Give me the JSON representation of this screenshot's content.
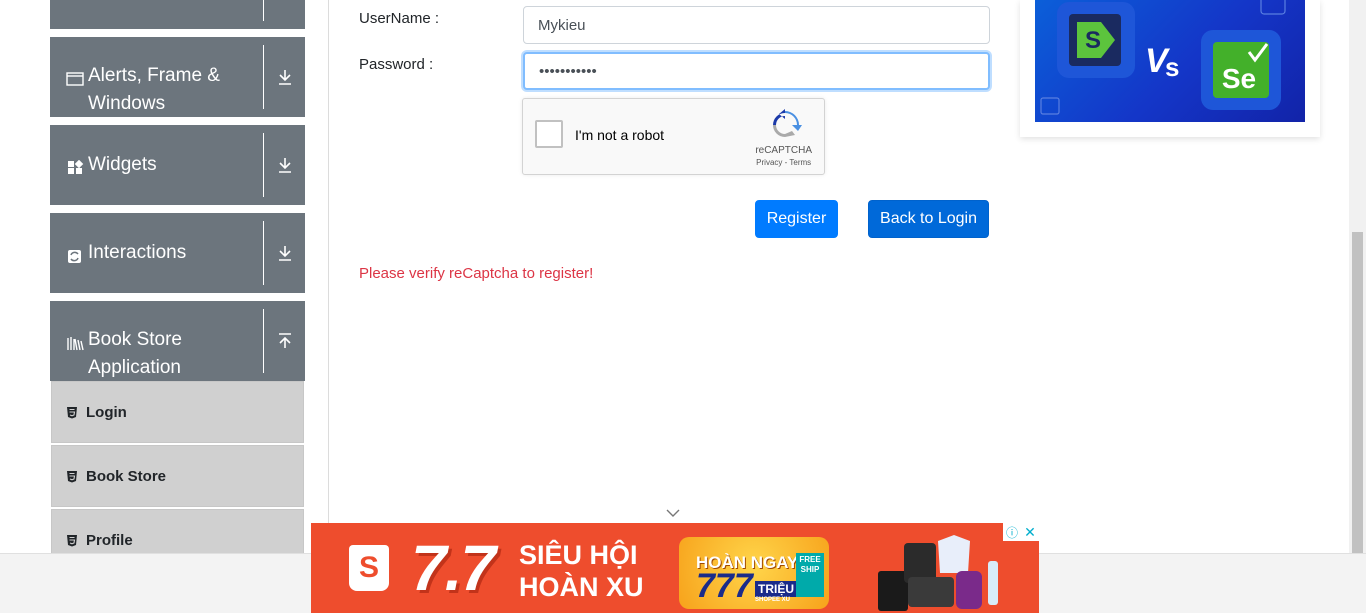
{
  "sidebar": {
    "groups": [
      {
        "label_line1": "Alerts, Frame &",
        "label_line2": "Windows",
        "icon": "window-icon",
        "arrow": "download-arrow-icon"
      },
      {
        "label": "Widgets",
        "icon": "widgets-icon",
        "arrow": "download-arrow-icon"
      },
      {
        "label": "Interactions",
        "icon": "interactions-icon",
        "arrow": "download-arrow-icon"
      },
      {
        "label_line1": "Book Store",
        "label_line2": "Application",
        "icon": "books-icon",
        "arrow": "upload-arrow-icon"
      }
    ],
    "sub_items": [
      {
        "label": "Login",
        "icon": "html5-icon"
      },
      {
        "label": "Book Store",
        "icon": "html5-icon"
      },
      {
        "label": "Profile",
        "icon": "html5-icon"
      }
    ]
  },
  "form": {
    "username_label": "UserName :",
    "username_value": "Mykieu",
    "password_label": "Password :",
    "password_value": "•••••••••••"
  },
  "captcha": {
    "text": "I'm not a robot",
    "brand": "reCAPTCHA",
    "links": "Privacy - Terms"
  },
  "buttons": {
    "register": "Register",
    "back": "Back to Login"
  },
  "error": "Please verify reCaptcha to register!",
  "ad": {
    "headline": "7.7",
    "line1": "SIÊU HỘI",
    "line2": "HOÀN XU",
    "badge_title": "HOÀN NGAY",
    "badge_amount": "777",
    "badge_unit": "TRIỆU",
    "badge_sub": "SHOPEE XU",
    "free_ship": "FREE SHIP",
    "shop_letter": "S",
    "info": "ⓘ",
    "close": "✕"
  },
  "colors": {
    "sidebar_group": "#6c757d",
    "sub_item": "#d0d0d0",
    "primary": "#007bff",
    "error": "#dc3545",
    "ad_bg": "#ee4d2d"
  }
}
